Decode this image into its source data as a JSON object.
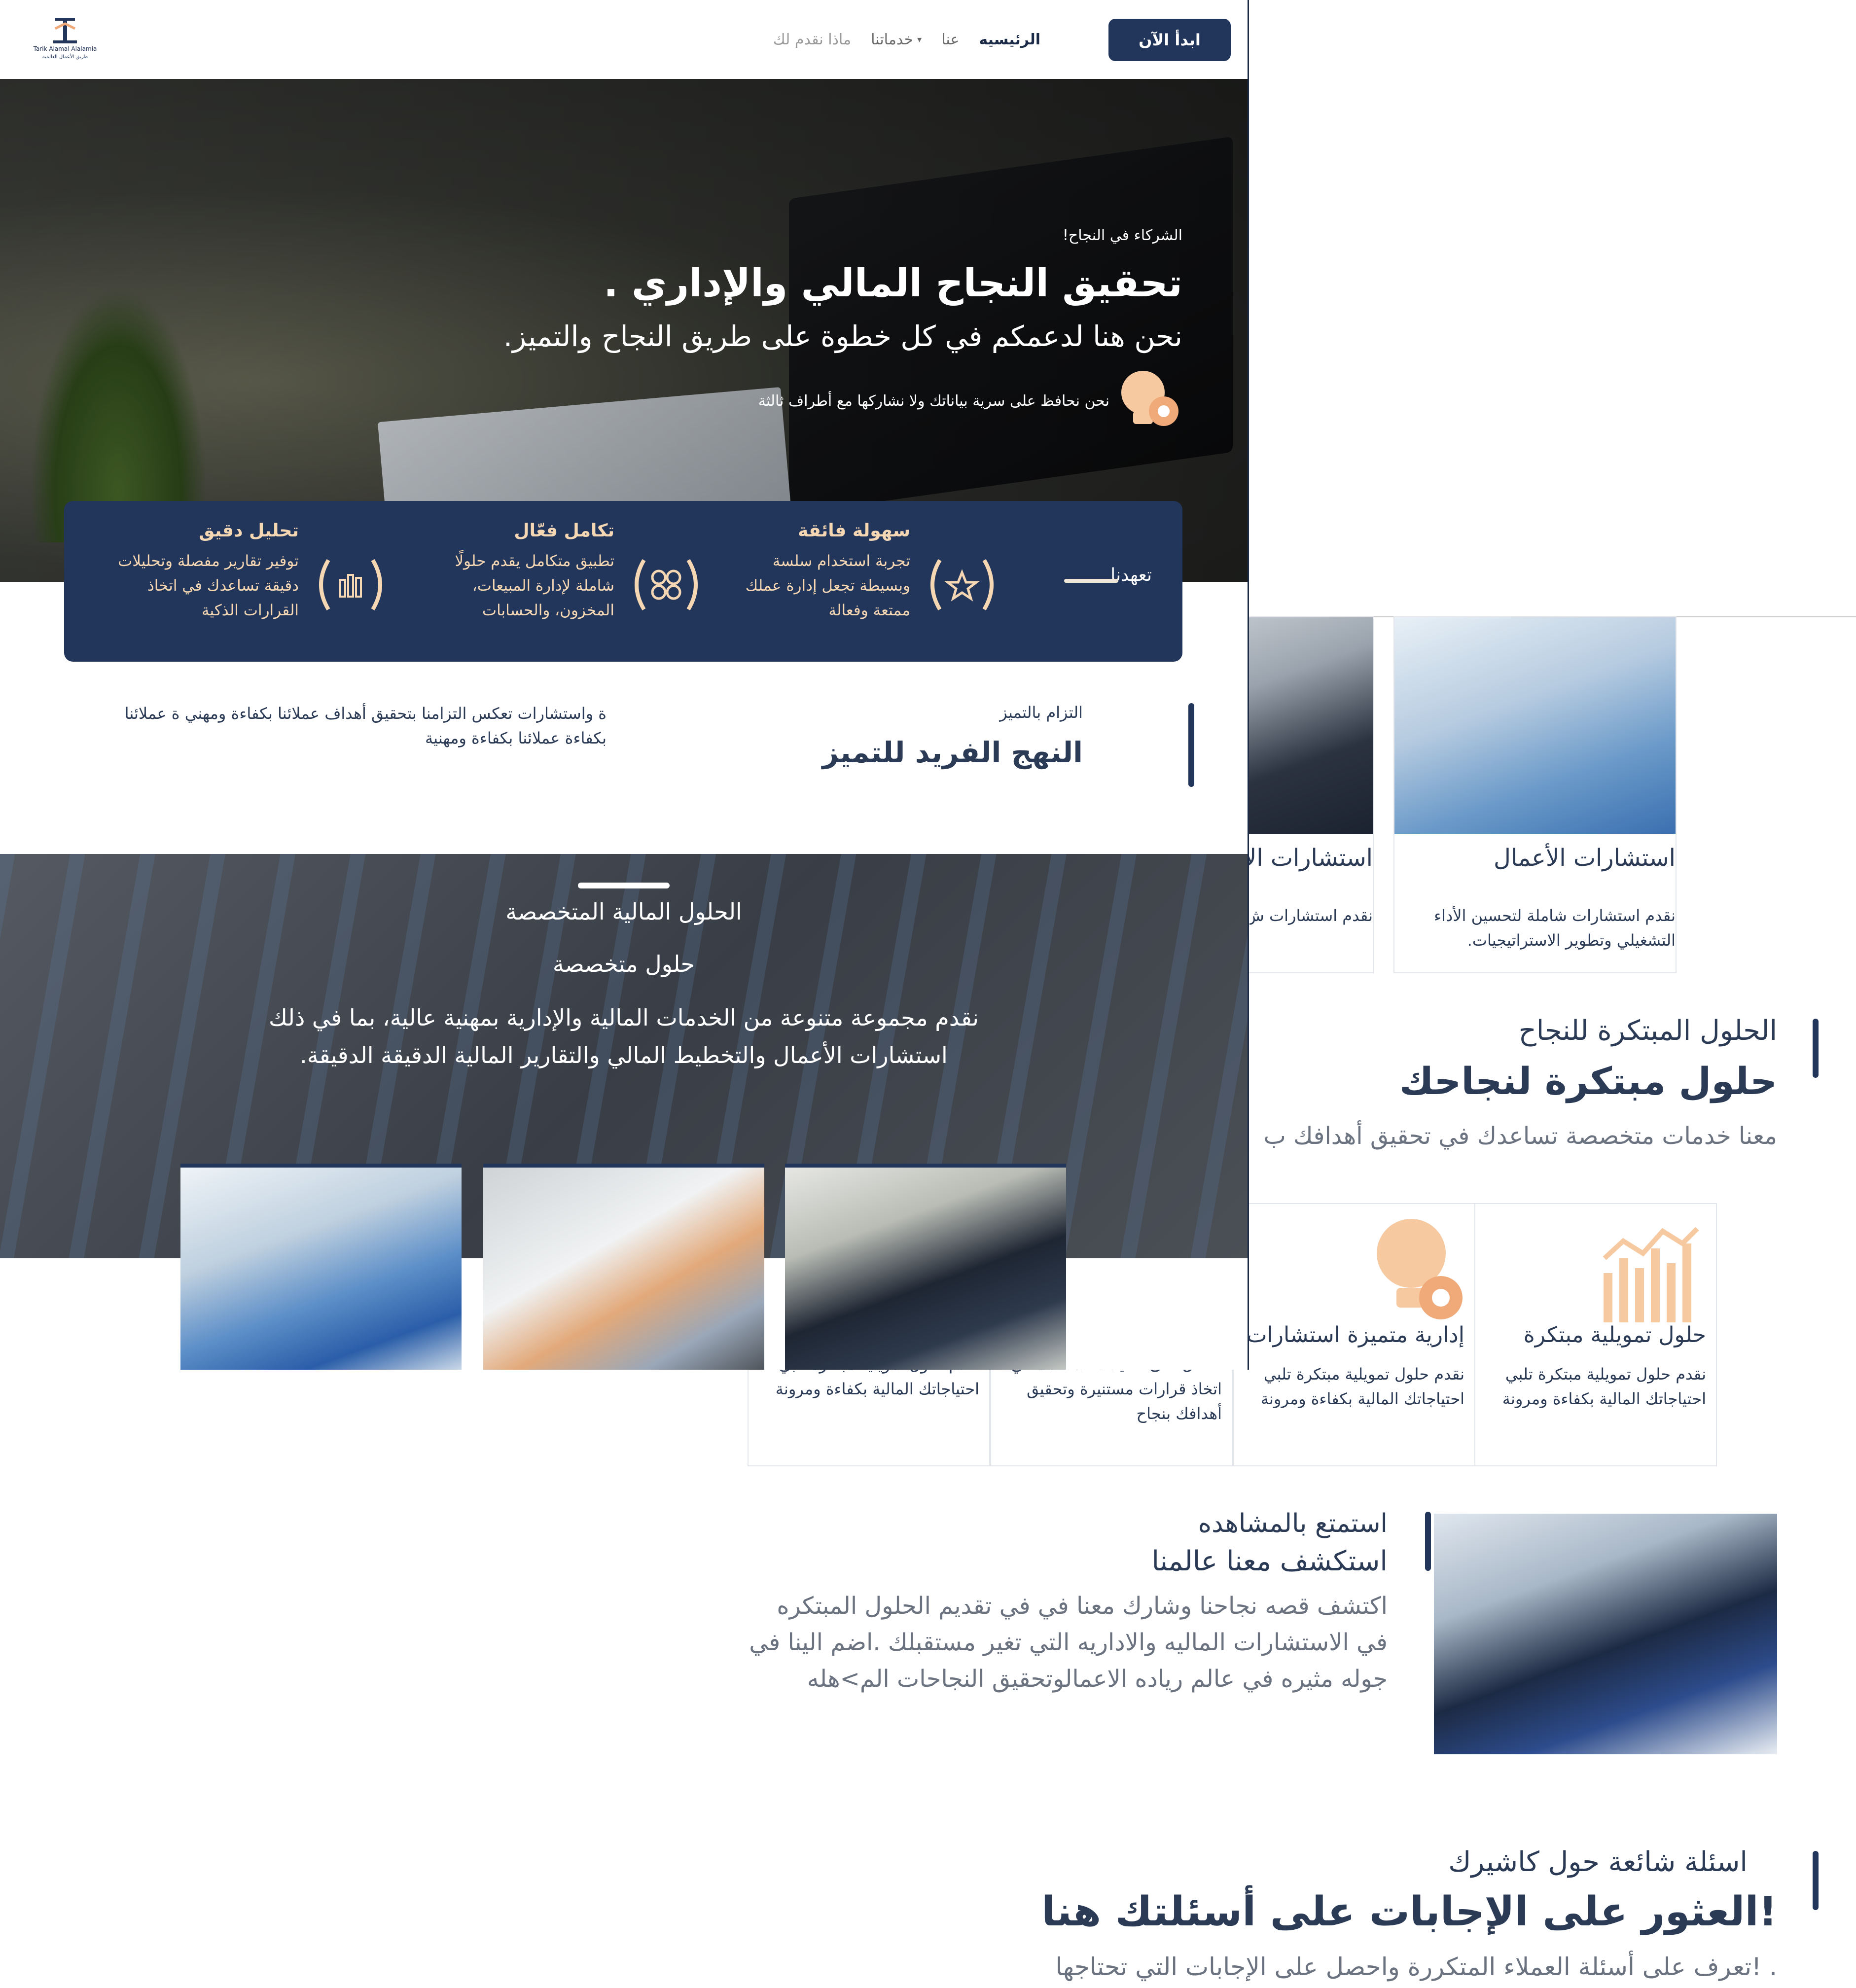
{
  "navbar": {
    "logo_text": "Tarik Alamal Alalamia",
    "logo_subtext": "طريق الأعمال العالمية",
    "cta": "ابدأ الآن",
    "menu": [
      {
        "label": "الرئيسيه"
      },
      {
        "label": "عنا"
      },
      {
        "label": "خدماتنا"
      },
      {
        "label": "ماذا نقدم لك"
      }
    ]
  },
  "hero": {
    "kicker": "الشركاء في النجاح!",
    "title": "تحقيق النجاح المالي والإداري .",
    "subtitle": "نحن هنا لدعمكم في كل خطوة على طريق النجاح والتميز.",
    "privacy": "نحن نحافظ على سرية بياناتك ولا نشاركها مع أطراف ثالثة"
  },
  "features": {
    "label": "تعهدنا",
    "items": [
      {
        "title": "سهولة فائقة",
        "desc": "تجربة استخدام سلسة وبسيطة تجعل إدارة عملك ممتعة وفعالة",
        "icon": "star-icon"
      },
      {
        "title": "تكامل فعّال",
        "desc": "تطبيق متكامل يقدم حلولًا شاملة لإدارة المبيعات، المخزون، والحسابات",
        "icon": "grid-icon"
      },
      {
        "title": "تحليل دقيق",
        "desc": "توفير تقارير مفصلة وتحليلات دقيقة تساعدك في اتخاذ القرارات الذكية",
        "icon": "bar-chart-icon"
      }
    ]
  },
  "commitment": {
    "kicker": "التزام بالتميز",
    "title": "النهج الفريد للتميز",
    "text": "ة واستشارات تعكس التزامنا بتحقيق أهداف عملائنا بكفاءة ومهني ة عملائنا بكفاءة عملائنا بكفاءة ومهنية"
  },
  "solutions": {
    "kicker": "الحلول المالية المتخصصة",
    "title": "حلول متخصصة",
    "desc": "نقدم مجموعة متنوعة من الخدمات المالية والإدارية بمهنية عالية، بما في ذلك استشارات الأعمال والتخطيط المالي والتقارير المالية الدقيقة الدقيقة."
  },
  "service_cards": [
    {
      "title": "استشارات الأعمال",
      "desc": "نقدم استشارات شاملة لتحسين الأداء التشغيلي وتطوير الاستراتيجيات."
    },
    {
      "title": "استشارات الأ",
      "desc": "نقدم استشارات ش التشغيلي وتطوير"
    }
  ],
  "innovative": {
    "kicker": "الحلول المبتكرة للنجاح",
    "title": "حلول مبتكرة لنجاحك",
    "desc": "معنا خدمات متخصصة تساعدك في تحقيق أهدافك ب"
  },
  "offers": [
    {
      "title": "حلول تمويلية مبتكرة",
      "desc": "نقدم حلول تمويلية مبتكرة تلبي احتياجاتك المالية بكفاءة ومرونة"
    },
    {
      "title": "إدارية متميزة استشارات",
      "desc": "نقدم حلول تمويلية مبتكرة تلبي احتياجاتك المالية بكفاءة ومرونة"
    },
    {
      "title": "",
      "desc": "احصل على تحليلات تساعدك في اتخاذ قرارات مستنيرة وتحقيق أهدافك بنجاح"
    },
    {
      "title": "",
      "desc": "نقدم حلول تمويلية مبتكرة تلبي احتياجاتك المالية بكفاءة ومرونة"
    }
  ],
  "watch": {
    "kicker": "استمتع بالمشاهده",
    "title": "استكشف معنا عالمنا",
    "desc": "اكتشف قصه نجاحنا وشارك معنا في في تقديم الحلول المبتكره في الاستشارات الماليه والاداريه التي تغير مستقبلك .اضم الينا في جوله مثيره في عالم رياده الاعمالوتحقيق النجاحات الم>هله"
  },
  "faq": {
    "kicker": "اسئلة شائعة حول كاشيرك",
    "title": "العثور على الإجابات على أسئلتك هنا!",
    "desc": "تعرف على أسئلة العملاء المتكررة واحصل على الإجابات التي تحتاجها! ."
  },
  "colors": {
    "navy": "#22355a",
    "accent": "#f6c9a0",
    "muted": "#6b7280"
  }
}
